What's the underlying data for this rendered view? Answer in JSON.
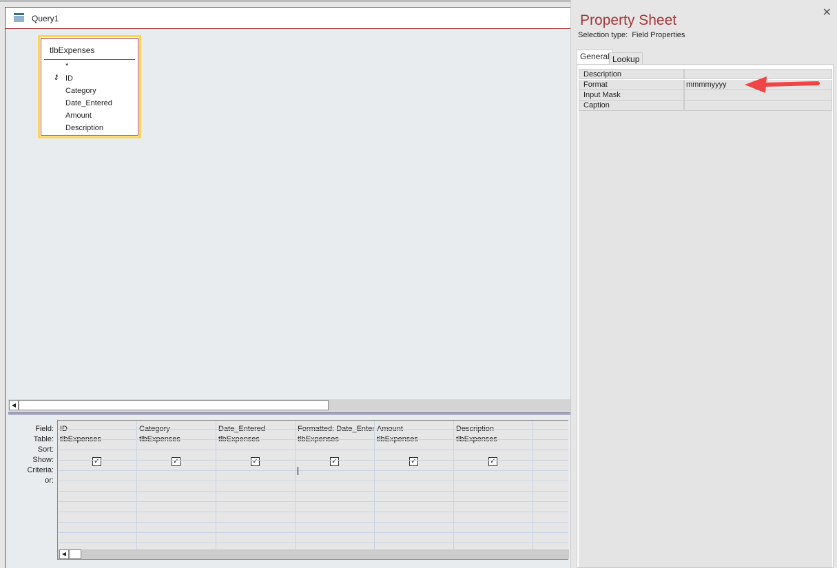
{
  "document": {
    "title": "Query1"
  },
  "table_box": {
    "name": "tlbExpenses",
    "fields": [
      "*",
      "ID",
      "Category",
      "Date_Entered",
      "Amount",
      "Description"
    ]
  },
  "grid": {
    "row_labels": [
      "Field:",
      "Table:",
      "Sort:",
      "Show:",
      "Criteria:",
      "or:"
    ],
    "columns": [
      {
        "field": "ID",
        "table": "tlbExpenses",
        "show": true
      },
      {
        "field": "Category",
        "table": "tlbExpenses",
        "show": true
      },
      {
        "field": "Date_Entered",
        "table": "tlbExpenses",
        "show": true
      },
      {
        "field": "Formatted: Date_Entered",
        "table": "tlbExpenses",
        "show": true
      },
      {
        "field": "Amount",
        "table": "tlbExpenses",
        "show": true
      },
      {
        "field": "Description",
        "table": "tlbExpenses",
        "show": true
      }
    ]
  },
  "property_sheet": {
    "title": "Property Sheet",
    "selection_label": "Selection type:",
    "selection_type": "Field Properties",
    "tabs": [
      "General",
      "Lookup"
    ],
    "active_tab": "General",
    "properties": [
      {
        "name": "Description",
        "value": ""
      },
      {
        "name": "Format",
        "value": "mmmmyyyy"
      },
      {
        "name": "Input Mask",
        "value": ""
      },
      {
        "name": "Caption",
        "value": ""
      }
    ],
    "arrow_color": "#f04545"
  }
}
